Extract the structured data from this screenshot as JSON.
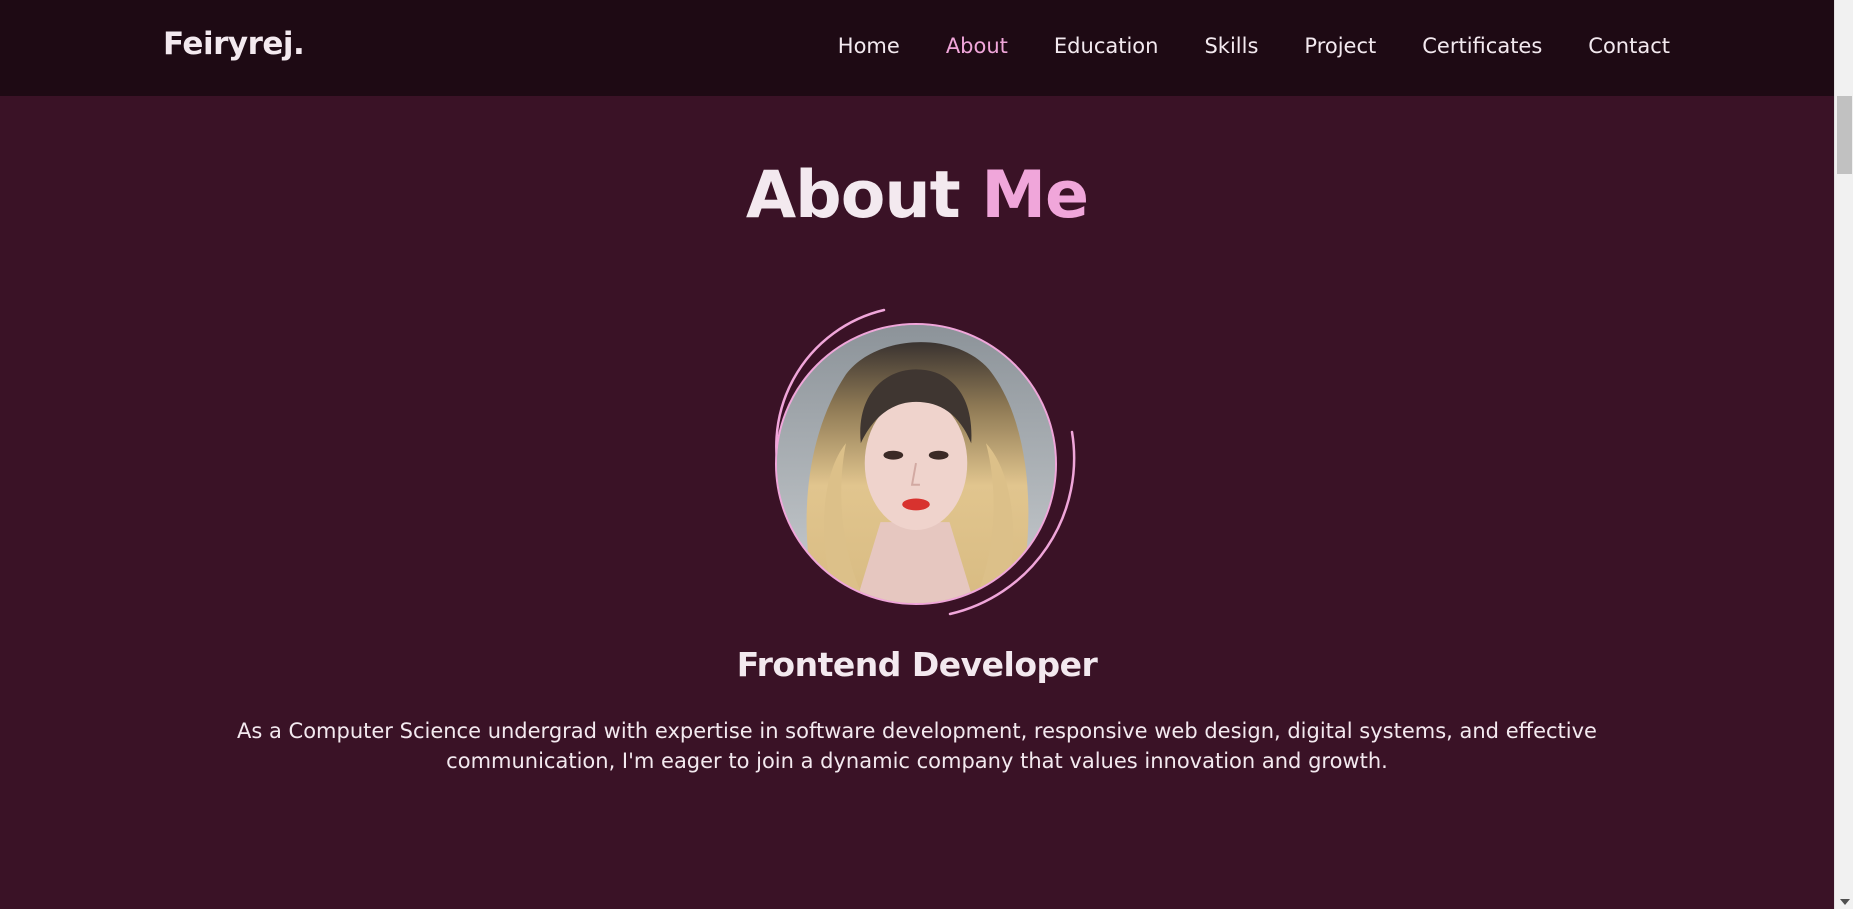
{
  "header": {
    "logo": "Feiryrej.",
    "nav": [
      {
        "label": "Home",
        "active": false
      },
      {
        "label": "About",
        "active": true
      },
      {
        "label": "Education",
        "active": false
      },
      {
        "label": "Skills",
        "active": false
      },
      {
        "label": "Project",
        "active": false
      },
      {
        "label": "Certificates",
        "active": false
      },
      {
        "label": "Contact",
        "active": false
      }
    ]
  },
  "about": {
    "title_main": "About",
    "title_accent": "Me",
    "role": "Frontend Developer",
    "description": "As a Computer Science undergrad with expertise in software development, responsive web design, digital systems, and effective communication, I'm eager to join a dynamic company that values innovation and growth."
  },
  "colors": {
    "background": "#3a1226",
    "header_background": "#1e0a14",
    "accent": "#f0a6da",
    "text": "#f3e9ef"
  },
  "icons": {
    "scroll_down": "chevron-down-icon"
  }
}
